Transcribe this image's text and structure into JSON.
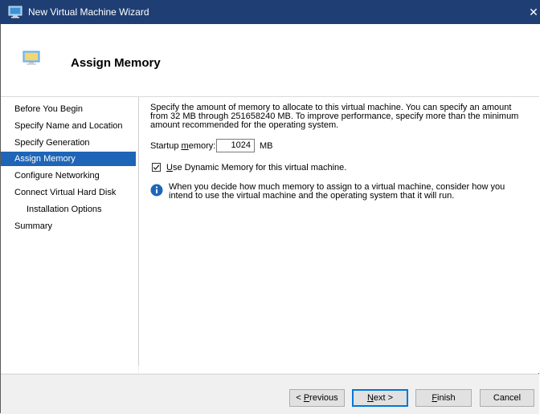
{
  "window": {
    "title": "New Virtual Machine Wizard",
    "close_glyph": "✕"
  },
  "header": {
    "title": "Assign Memory"
  },
  "sidebar": {
    "items": [
      {
        "label": "Before You Begin"
      },
      {
        "label": "Specify Name and Location"
      },
      {
        "label": "Specify Generation"
      },
      {
        "label": "Assign Memory",
        "selected": true
      },
      {
        "label": "Configure Networking"
      },
      {
        "label": "Connect Virtual Hard Disk"
      },
      {
        "label": "Installation Options",
        "indent": true
      },
      {
        "label": "Summary"
      }
    ]
  },
  "content": {
    "description": "Specify the amount of memory to allocate to this virtual machine. You can specify an amount from 32 MB through 251658240 MB. To improve performance, specify more than the minimum amount recommended for the operating system.",
    "startup_label_prefix": "Startup ",
    "startup_label_accel": "m",
    "startup_label_suffix": "emory:",
    "startup_memory_value": "1024",
    "memory_unit": "MB",
    "dynamic_memory_checked": true,
    "dynamic_label_accel": "U",
    "dynamic_label_rest": "se Dynamic Memory for this virtual machine.",
    "info_text": "When you decide how much memory to assign to a virtual machine, consider how you intend to use the virtual machine and the operating system that it will run."
  },
  "footer": {
    "previous": {
      "prefix": "< ",
      "accel": "P",
      "rest": "revious"
    },
    "next": {
      "accel": "N",
      "rest": "ext >"
    },
    "finish": {
      "accel": "F",
      "rest": "inish"
    },
    "cancel": "Cancel"
  },
  "colors": {
    "titlebar": "#1f3f74",
    "selected": "#1f65b7",
    "info_icon": "#1f65b7"
  }
}
